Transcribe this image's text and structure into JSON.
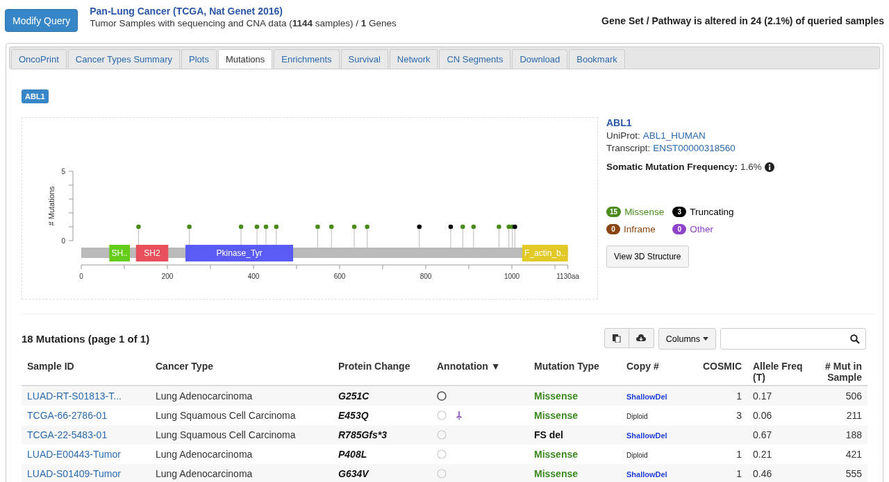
{
  "header": {
    "button": "Modify Query",
    "study_title": "Pan-Lung Cancer (TCGA, Nat Genet 2016)",
    "study_subtitle": "Tumor Samples with sequencing and CNA data  (**1144** samples) / **1** Genes",
    "alteration_summary": "Gene Set / Pathway is altered in 24 (2.1%) of queried samples"
  },
  "tabs": [
    {
      "label": "OncoPrint",
      "selected": false
    },
    {
      "label": "Cancer Types Summary",
      "selected": false
    },
    {
      "label": "Plots",
      "selected": false
    },
    {
      "label": "Mutations",
      "selected": true
    },
    {
      "label": "Enrichments",
      "selected": false
    },
    {
      "label": "Survival",
      "selected": false
    },
    {
      "label": "Network",
      "selected": false
    },
    {
      "label": "CN Segments",
      "selected": false
    },
    {
      "label": "Download",
      "selected": false
    },
    {
      "label": "Bookmark",
      "selected": false
    }
  ],
  "gene_badge": "ABL1",
  "lollipop": {
    "chart_data": {
      "type": "scatter",
      "ylabel": "# Mutations",
      "xlim": [
        0,
        1130
      ],
      "ylim": [
        0,
        5
      ],
      "yticks": [
        0,
        5
      ],
      "xticks": [
        0,
        200,
        400,
        600,
        800,
        {
          "value": 1000,
          "label": "1000"
        },
        {
          "value": 1130,
          "label": "1130aa"
        }
      ],
      "x": [
        133,
        251,
        371,
        408,
        429,
        453,
        549,
        581,
        634,
        664,
        785,
        858,
        886,
        911,
        970,
        993,
        1001,
        1007
      ],
      "series": [
        {
          "name": "Missense",
          "color": "#4a8c1c",
          "values": [
            1,
            1,
            1,
            1,
            1,
            1,
            1,
            1,
            1,
            1,
            null,
            null,
            1,
            1,
            1,
            1,
            1,
            null
          ]
        },
        {
          "name": "Truncating",
          "color": "#000000",
          "values": [
            null,
            null,
            null,
            null,
            null,
            null,
            null,
            null,
            null,
            null,
            1,
            1,
            null,
            null,
            null,
            null,
            null,
            1
          ]
        }
      ]
    },
    "domains": [
      {
        "label": "SH..",
        "color": "#66cc1a"
      },
      {
        "label": "SH2",
        "color": "#e8505b"
      },
      {
        "label": "Pkinase_Tyr",
        "color": "#5a5af5"
      },
      {
        "label": "F_actin_b..",
        "color": "#e3c926"
      }
    ]
  },
  "gene_info": {
    "name": "ABL1",
    "uniprot_label": "UniProt:",
    "uniprot": "ABL1_HUMAN",
    "transcript_label": "Transcript:",
    "transcript": "ENST00000318560",
    "frequency_label": "Somatic Mutation Frequency:",
    "frequency": "1.6%"
  },
  "legend": [
    {
      "count": "15"
    },
    {
      "count": "3"
    },
    {
      "count": "0",
      "label": "Inframe",
      "color": "#8b4513"
    },
    {
      "count": "0",
      "label": "Other",
      "color": "#8e44c8"
    }
  ],
  "structure_button": "View 3D Structure",
  "table": {
    "title": "18 Mutations (page 1 of 1)",
    "columns_button": "Columns",
    "columns": [
      "Sample ID",
      "Cancer Type",
      "Protein Change",
      "Annotation ▼",
      "Mutation Type",
      "Copy #",
      "COSMIC",
      "Allele Freq (T)",
      "# Mut in Sample"
    ],
    "rows": [
      {
        "sample_id": "LUAD-RT-S01813-T...",
        "cancer_type": "Lung Adenocarcinoma",
        "protein_change": "G251C",
        "oncokb_annotated": true,
        "civic": false,
        "mutation_type": {
          "text": "Missense",
          "kind": "missense"
        },
        "copy_number": {
          "text": "ShallowDel",
          "kind": "shallowdel"
        },
        "cosmic": "1",
        "allele_freq": "0.17",
        "mut_in_sample": "506"
      },
      {
        "sample_id": "TCGA-66-2786-01",
        "cancer_type": "Lung Squamous Cell Carcinoma",
        "protein_change": "E453Q",
        "oncokb_annotated": false,
        "civic": true,
        "mutation_type": {
          "text": "Missense",
          "kind": "missense"
        },
        "copy_number": {
          "text": "Diploid",
          "kind": "diploid"
        },
        "cosmic": "3",
        "allele_freq": "0.06",
        "mut_in_sample": "211"
      },
      {
        "sample_id": "TCGA-22-5483-01",
        "cancer_type": "Lung Squamous Cell Carcinoma",
        "protein_change": "R785Gfs*3",
        "oncokb_annotated": false,
        "civic": false,
        "mutation_type": {
          "text": "FS del",
          "kind": "truncating"
        },
        "copy_number": {
          "text": "ShallowDel",
          "kind": "shallowdel"
        },
        "allele_freq": "0.67",
        "mut_in_sample": "188"
      },
      {
        "sample_id": "LUAD-E00443-Tumor",
        "cancer_type": "Lung Adenocarcinoma",
        "protein_change": "P408L",
        "oncokb_annotated": false,
        "civic": false,
        "mutation_type": {
          "text": "Missense",
          "kind": "missense"
        },
        "copy_number": {
          "text": "Diploid",
          "kind": "diploid"
        },
        "cosmic": "1",
        "allele_freq": "0.21",
        "mut_in_sample": "421"
      },
      {
        "sample_id": "LUAD-S01409-Tumor",
        "cancer_type": "Lung Adenocarcinoma",
        "protein_change": "G634V",
        "oncokb_annotated": false,
        "civic": false,
        "mutation_type": {
          "text": "Missense",
          "kind": "missense"
        },
        "copy_number": {
          "text": "ShallowDel",
          "kind": "shallowdel"
        },
        "cosmic": "1",
        "allele_freq": "0.46",
        "mut_in_sample": "555"
      }
    ]
  }
}
